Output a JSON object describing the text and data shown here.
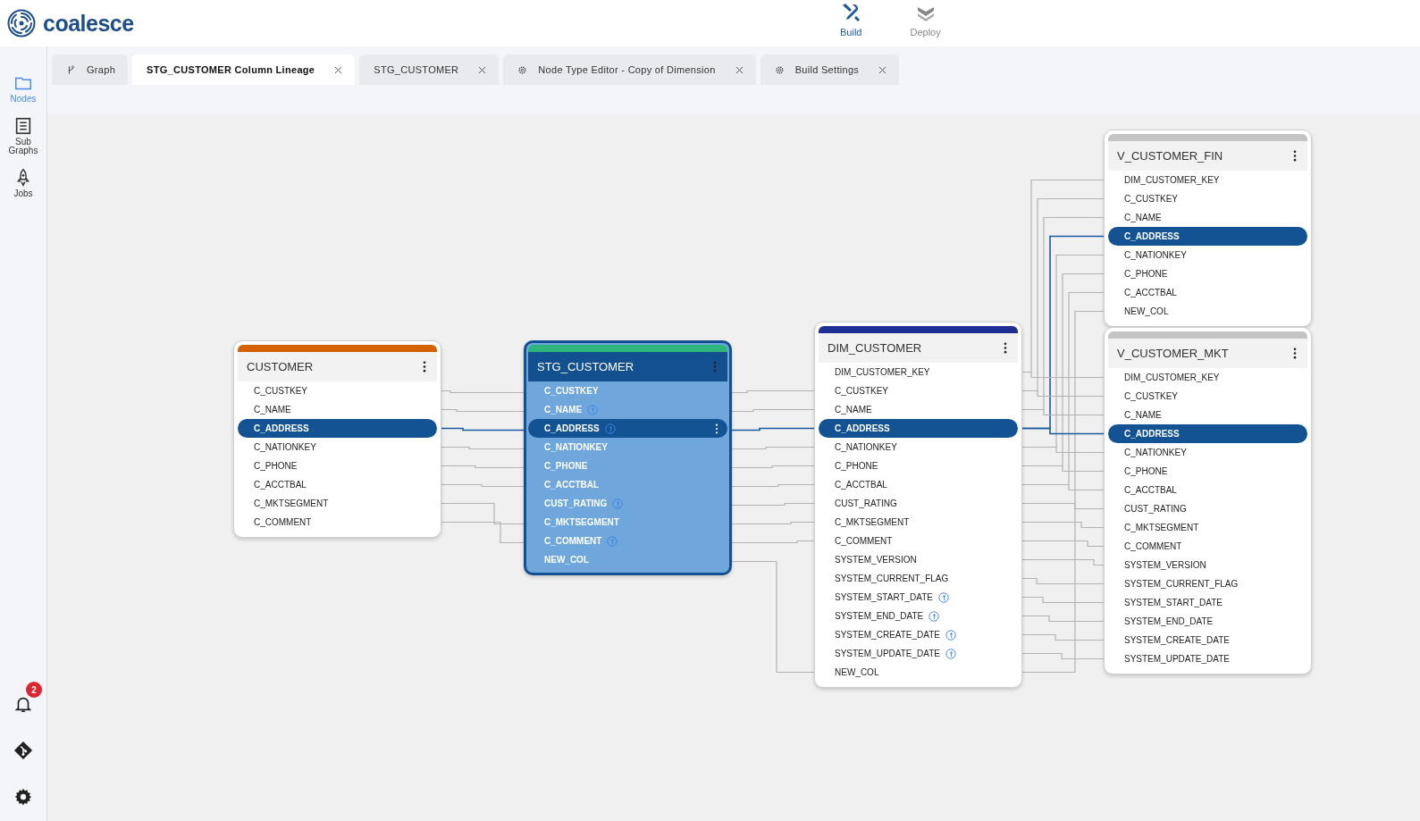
{
  "header": {
    "logo_text": "coalesce",
    "modes": [
      {
        "label": "Build",
        "kind": "build",
        "selected": true
      },
      {
        "label": "Deploy",
        "kind": "deploy",
        "selected": false
      }
    ]
  },
  "sidebar": {
    "items": [
      {
        "label": "Nodes",
        "kind": "folder",
        "selected": true
      },
      {
        "label": "Sub Graphs",
        "kind": "subgraph",
        "selected": false
      },
      {
        "label": "Jobs",
        "kind": "rocket",
        "selected": false
      }
    ],
    "bottom": [
      {
        "kind": "bell",
        "badge": "2"
      },
      {
        "kind": "git"
      },
      {
        "kind": "settings"
      }
    ]
  },
  "tabs": [
    {
      "label": "Graph",
      "kind": "graph",
      "closable": false,
      "selected": false
    },
    {
      "label": "STG_CUSTOMER Column Lineage",
      "kind": "lineage",
      "closable": true,
      "selected": true
    },
    {
      "label": "STG_CUSTOMER",
      "kind": "node",
      "closable": true,
      "selected": false
    },
    {
      "label": "Node Type Editor - Copy of Dimension",
      "kind": "editor",
      "closable": true,
      "selected": false
    },
    {
      "label": "Build Settings",
      "kind": "settings",
      "closable": true,
      "selected": false
    }
  ],
  "nodes": [
    {
      "name": "CUSTOMER",
      "color": "#d56200",
      "active": false,
      "columns": [
        {
          "name": "C_CUSTKEY",
          "selected": false,
          "transform": false
        },
        {
          "name": "C_NAME",
          "selected": false,
          "transform": false
        },
        {
          "name": "C_ADDRESS",
          "selected": true,
          "transform": false
        },
        {
          "name": "C_NATIONKEY",
          "selected": false,
          "transform": false
        },
        {
          "name": "C_PHONE",
          "selected": false,
          "transform": false
        },
        {
          "name": "C_ACCTBAL",
          "selected": false,
          "transform": false
        },
        {
          "name": "C_MKTSEGMENT",
          "selected": false,
          "transform": false
        },
        {
          "name": "C_COMMENT",
          "selected": false,
          "transform": false
        }
      ]
    },
    {
      "name": "STG_CUSTOMER",
      "color": "#2eb67d",
      "active": true,
      "columns": [
        {
          "name": "C_CUSTKEY",
          "selected": false,
          "transform": false
        },
        {
          "name": "C_NAME",
          "selected": false,
          "transform": true
        },
        {
          "name": "C_ADDRESS",
          "selected": true,
          "transform": true
        },
        {
          "name": "C_NATIONKEY",
          "selected": false,
          "transform": false
        },
        {
          "name": "C_PHONE",
          "selected": false,
          "transform": false
        },
        {
          "name": "C_ACCTBAL",
          "selected": false,
          "transform": false
        },
        {
          "name": "CUST_RATING",
          "selected": false,
          "transform": true
        },
        {
          "name": "C_MKTSEGMENT",
          "selected": false,
          "transform": false
        },
        {
          "name": "C_COMMENT",
          "selected": false,
          "transform": true
        },
        {
          "name": "NEW_COL",
          "selected": false,
          "transform": false
        }
      ]
    },
    {
      "name": "DIM_CUSTOMER",
      "color": "#1f2f94",
      "active": false,
      "columns": [
        {
          "name": "DIM_CUSTOMER_KEY",
          "selected": false,
          "transform": false
        },
        {
          "name": "C_CUSTKEY",
          "selected": false,
          "transform": false
        },
        {
          "name": "C_NAME",
          "selected": false,
          "transform": false
        },
        {
          "name": "C_ADDRESS",
          "selected": true,
          "transform": false
        },
        {
          "name": "C_NATIONKEY",
          "selected": false,
          "transform": false
        },
        {
          "name": "C_PHONE",
          "selected": false,
          "transform": false
        },
        {
          "name": "C_ACCTBAL",
          "selected": false,
          "transform": false
        },
        {
          "name": "CUST_RATING",
          "selected": false,
          "transform": false
        },
        {
          "name": "C_MKTSEGMENT",
          "selected": false,
          "transform": false
        },
        {
          "name": "C_COMMENT",
          "selected": false,
          "transform": false
        },
        {
          "name": "SYSTEM_VERSION",
          "selected": false,
          "transform": false
        },
        {
          "name": "SYSTEM_CURRENT_FLAG",
          "selected": false,
          "transform": false
        },
        {
          "name": "SYSTEM_START_DATE",
          "selected": false,
          "transform": true
        },
        {
          "name": "SYSTEM_END_DATE",
          "selected": false,
          "transform": true
        },
        {
          "name": "SYSTEM_CREATE_DATE",
          "selected": false,
          "transform": true
        },
        {
          "name": "SYSTEM_UPDATE_DATE",
          "selected": false,
          "transform": true
        },
        {
          "name": "NEW_COL",
          "selected": false,
          "transform": false
        }
      ]
    },
    {
      "name": "V_CUSTOMER_FIN",
      "color": "#c4c4c4",
      "active": false,
      "columns": [
        {
          "name": "DIM_CUSTOMER_KEY",
          "selected": false,
          "transform": false
        },
        {
          "name": "C_CUSTKEY",
          "selected": false,
          "transform": false
        },
        {
          "name": "C_NAME",
          "selected": false,
          "transform": false
        },
        {
          "name": "C_ADDRESS",
          "selected": true,
          "transform": false
        },
        {
          "name": "C_NATIONKEY",
          "selected": false,
          "transform": false
        },
        {
          "name": "C_PHONE",
          "selected": false,
          "transform": false
        },
        {
          "name": "C_ACCTBAL",
          "selected": false,
          "transform": false
        },
        {
          "name": "NEW_COL",
          "selected": false,
          "transform": false
        }
      ]
    },
    {
      "name": "V_CUSTOMER_MKT",
      "color": "#c4c4c4",
      "active": false,
      "columns": [
        {
          "name": "DIM_CUSTOMER_KEY",
          "selected": false,
          "transform": false
        },
        {
          "name": "C_CUSTKEY",
          "selected": false,
          "transform": false
        },
        {
          "name": "C_NAME",
          "selected": false,
          "transform": false
        },
        {
          "name": "C_ADDRESS",
          "selected": true,
          "transform": false
        },
        {
          "name": "C_NATIONKEY",
          "selected": false,
          "transform": false
        },
        {
          "name": "C_PHONE",
          "selected": false,
          "transform": false
        },
        {
          "name": "C_ACCTBAL",
          "selected": false,
          "transform": false
        },
        {
          "name": "CUST_RATING",
          "selected": false,
          "transform": false
        },
        {
          "name": "C_MKTSEGMENT",
          "selected": false,
          "transform": false
        },
        {
          "name": "C_COMMENT",
          "selected": false,
          "transform": false
        },
        {
          "name": "SYSTEM_VERSION",
          "selected": false,
          "transform": false
        },
        {
          "name": "SYSTEM_CURRENT_FLAG",
          "selected": false,
          "transform": false
        },
        {
          "name": "SYSTEM_START_DATE",
          "selected": false,
          "transform": false
        },
        {
          "name": "SYSTEM_END_DATE",
          "selected": false,
          "transform": false
        },
        {
          "name": "SYSTEM_CREATE_DATE",
          "selected": false,
          "transform": false
        },
        {
          "name": "SYSTEM_UPDATE_DATE",
          "selected": false,
          "transform": false
        }
      ]
    }
  ]
}
